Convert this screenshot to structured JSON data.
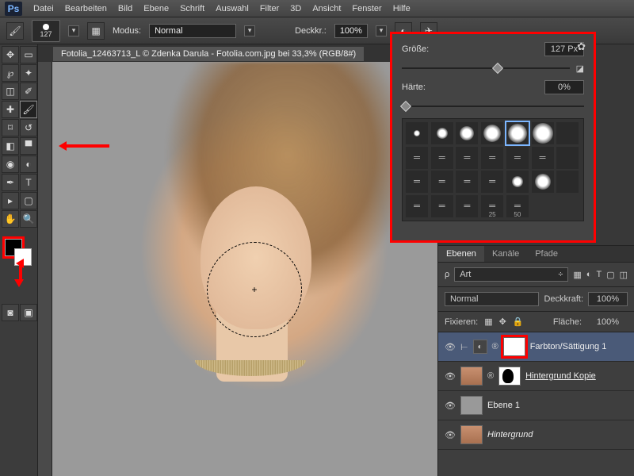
{
  "menu": {
    "items": [
      "Datei",
      "Bearbeiten",
      "Bild",
      "Ebene",
      "Schrift",
      "Auswahl",
      "Filter",
      "3D",
      "Ansicht",
      "Fenster",
      "Hilfe"
    ]
  },
  "optionsBar": {
    "brushSize": "127",
    "modeLabel": "Modus:",
    "modeValue": "Normal",
    "opacityLabel": "Deckkr.:",
    "opacityValue": "100%"
  },
  "documentTab": "Fotolia_12463713_L © Zdenka Darula - Fotolia.com.jpg bei 33,3% (RGB/8#)",
  "brushPanel": {
    "sizeLabel": "Größe:",
    "sizeValue": "127 Px",
    "hardnessLabel": "Härte:",
    "hardnessValue": "0%",
    "presetLabels": [
      "25",
      "50"
    ]
  },
  "layersPanel": {
    "tabs": [
      "Ebenen",
      "Kanäle",
      "Pfade"
    ],
    "filterLabel": "Art",
    "blendMode": "Normal",
    "opacityLabel": "Deckkraft:",
    "opacityValue": "100%",
    "lockLabel": "Fixieren:",
    "fillLabel": "Fläche:",
    "fillValue": "100%",
    "layers": [
      {
        "name": "Farbton/Sättigung 1"
      },
      {
        "name": "Hintergrund Kopie"
      },
      {
        "name": "Ebene 1"
      },
      {
        "name": "Hintergrund"
      }
    ]
  }
}
